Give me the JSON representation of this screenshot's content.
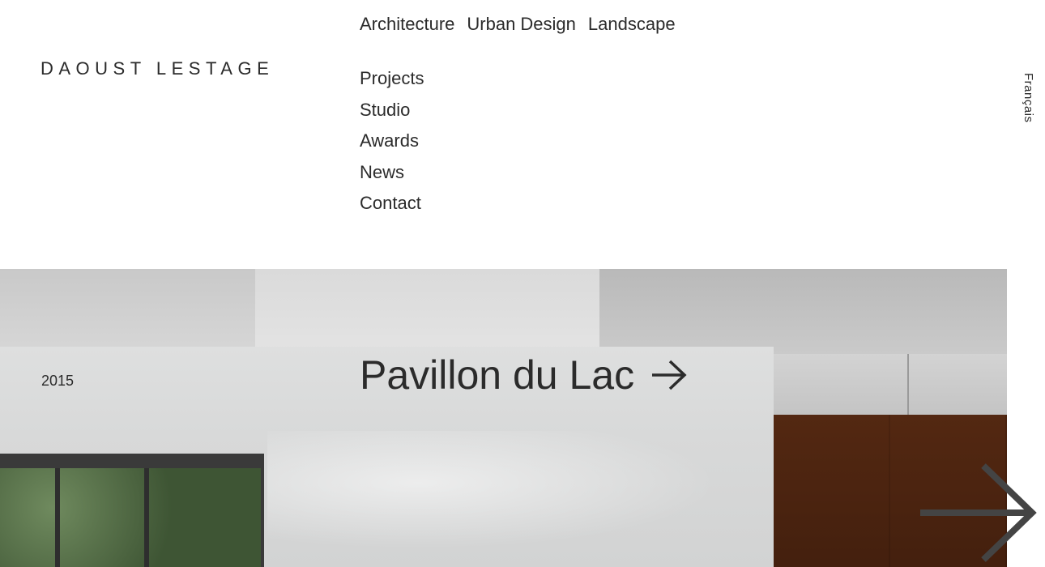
{
  "brand": {
    "logo": "DAOUST LESTAGE"
  },
  "top_nav": [
    {
      "label": "Architecture"
    },
    {
      "label": "Urban Design"
    },
    {
      "label": "Landscape"
    }
  ],
  "main_nav": [
    {
      "label": "Projects"
    },
    {
      "label": "Studio"
    },
    {
      "label": "Awards"
    },
    {
      "label": "News"
    },
    {
      "label": "Contact"
    }
  ],
  "language": {
    "label": "Français"
  },
  "hero": {
    "year": "2015",
    "title": "Pavillon du Lac",
    "title_arrow_icon": "arrow-right-icon",
    "next_icon": "large-arrow-right-icon"
  },
  "colors": {
    "text": "#2b2b2b",
    "background": "#ffffff"
  }
}
